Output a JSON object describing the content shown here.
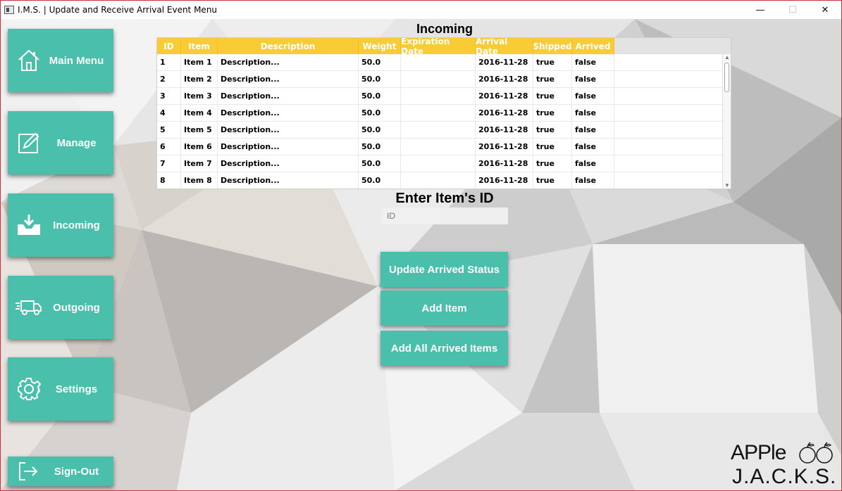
{
  "window": {
    "title": "I.M.S. | Update and Receive Arrival Event Menu",
    "minimize": "—",
    "maximize": "☐",
    "close": "✕"
  },
  "sidebar": {
    "items": [
      {
        "label": "Main Menu",
        "icon": "home-icon"
      },
      {
        "label": "Manage",
        "icon": "edit-icon"
      },
      {
        "label": "Incoming",
        "icon": "inbox-download-icon"
      },
      {
        "label": "Outgoing",
        "icon": "delivery-truck-icon"
      },
      {
        "label": "Settings",
        "icon": "gear-icon"
      },
      {
        "label": "Sign-Out",
        "icon": "sign-out-icon"
      }
    ]
  },
  "main": {
    "title": "Incoming",
    "table": {
      "columns": [
        "ID",
        "Item",
        "Description",
        "Weight",
        "Expiration Date",
        "Arrival Date",
        "Shipped",
        "Arrived"
      ],
      "rows": [
        [
          "1",
          "Item 1",
          "Description...",
          "50.0",
          "",
          "2016-11-28",
          "true",
          "false"
        ],
        [
          "2",
          "Item 2",
          "Description...",
          "50.0",
          "",
          "2016-11-28",
          "true",
          "false"
        ],
        [
          "3",
          "Item 3",
          "Description...",
          "50.0",
          "",
          "2016-11-28",
          "true",
          "false"
        ],
        [
          "4",
          "Item 4",
          "Description...",
          "50.0",
          "",
          "2016-11-28",
          "true",
          "false"
        ],
        [
          "5",
          "Item 5",
          "Description...",
          "50.0",
          "",
          "2016-11-28",
          "true",
          "false"
        ],
        [
          "6",
          "Item 6",
          "Description...",
          "50.0",
          "",
          "2016-11-28",
          "true",
          "false"
        ],
        [
          "7",
          "Item 7",
          "Description...",
          "50.0",
          "",
          "2016-11-28",
          "true",
          "false"
        ],
        [
          "8",
          "Item 8",
          "Description...",
          "50.0",
          "",
          "2016-11-28",
          "true",
          "false"
        ]
      ]
    },
    "enter_id_label": "Enter Item's ID",
    "id_input": {
      "placeholder": "ID",
      "value": ""
    },
    "buttons": {
      "update_arrived": "Update Arrived Status",
      "add_item": "Add Item",
      "add_all_arrived": "Add All Arrived Items"
    }
  },
  "logo": {
    "line1": "APPle",
    "line2": "J.A.C.K.S."
  },
  "colors": {
    "accent": "#4abfab",
    "header": "#f9cc35"
  }
}
